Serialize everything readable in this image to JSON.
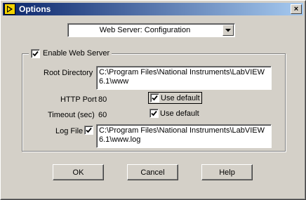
{
  "window": {
    "title": "Options",
    "close_glyph": "×"
  },
  "category_select": {
    "selected": "Web Server: Configuration"
  },
  "web_server": {
    "enable_label": "Enable Web Server",
    "enable_checked": true,
    "root_directory_label": "Root Directory",
    "root_directory_value": "C:\\Program Files\\National Instruments\\LabVIEW 6.1\\www",
    "http_port_label": "HTTP Port",
    "http_port_value": "80",
    "http_port_use_default_label": "Use default",
    "http_port_use_default_checked": true,
    "timeout_label": "Timeout (sec)",
    "timeout_value": "60",
    "timeout_use_default_label": "Use default",
    "timeout_use_default_checked": true,
    "log_file_label": "Log File",
    "log_file_checked": true,
    "log_file_value": "C:\\Program Files\\National Instruments\\LabVIEW 6.1\\www.log"
  },
  "buttons": {
    "ok": "OK",
    "cancel": "Cancel",
    "help": "Help"
  },
  "icons": {
    "app": "labview-icon",
    "dropdown": "chevron-down-icon",
    "check": "checkmark-icon"
  },
  "colors": {
    "titlebar_start": "#0a246a",
    "titlebar_end": "#a6caf0",
    "face": "#d4d0c8"
  }
}
